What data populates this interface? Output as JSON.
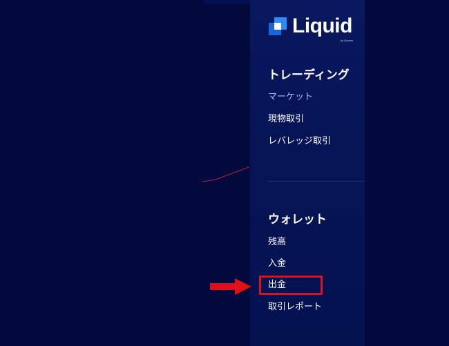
{
  "brand": {
    "name": "Liquid",
    "byline": "by Quoine"
  },
  "trading": {
    "title": "トレーディング",
    "items": [
      {
        "label": "マーケット",
        "active": true
      },
      {
        "label": "現物取引",
        "active": false
      },
      {
        "label": "レバレッジ取引",
        "active": false
      }
    ]
  },
  "wallet": {
    "title": "ウォレット",
    "items": [
      {
        "label": "残高"
      },
      {
        "label": "入金"
      },
      {
        "label": "出金",
        "highlighted": true
      },
      {
        "label": "取引レポート"
      }
    ]
  },
  "annotation": {
    "arrow_icon": "right-arrow-icon",
    "highlight_color": "#e0101a"
  },
  "colors": {
    "background": "#020a3d",
    "sidebar": "#061455",
    "active_link": "#aeb9ff",
    "logo_accent": "#1d7cf2"
  }
}
